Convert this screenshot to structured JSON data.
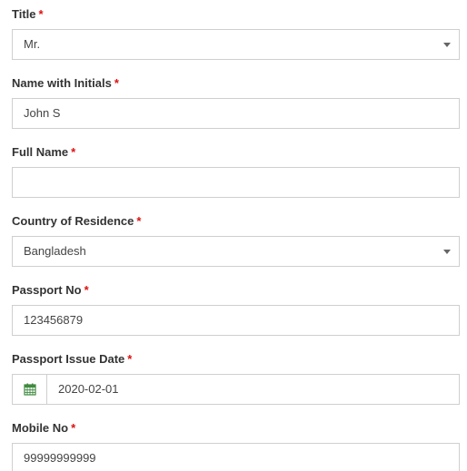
{
  "form": {
    "required_marker": "*",
    "title": {
      "label": "Title",
      "value": "Mr."
    },
    "name_with_initials": {
      "label": "Name with Initials",
      "value": "John S"
    },
    "full_name": {
      "label": "Full Name",
      "value": ""
    },
    "country_of_residence": {
      "label": "Country of Residence",
      "value": "Bangladesh"
    },
    "passport_no": {
      "label": "Passport No",
      "value": "123456879"
    },
    "passport_issue_date": {
      "label": "Passport Issue Date",
      "value": "2020-02-01",
      "icon": "calendar-icon"
    },
    "mobile_no": {
      "label": "Mobile No",
      "value": "99999999999"
    }
  },
  "colors": {
    "required": "#dd1111",
    "border": "#cfcfcf",
    "calendar_icon": "#3f8a3f"
  }
}
